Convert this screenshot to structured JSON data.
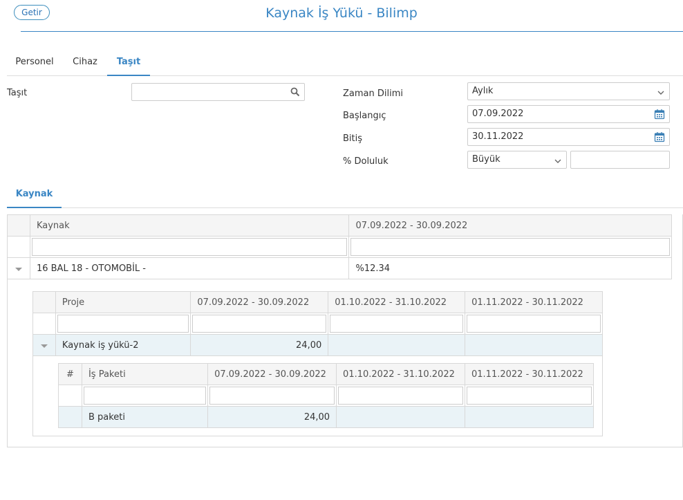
{
  "header": {
    "getir_label": "Getir",
    "title": "Kaynak İş Yükü - Bilimp"
  },
  "tabs": [
    {
      "label": "Personel"
    },
    {
      "label": "Cihaz"
    },
    {
      "label": "Taşıt"
    }
  ],
  "filters": {
    "tasit_label": "Taşıt",
    "tasit_value": "",
    "zaman_label": "Zaman Dilimi",
    "zaman_value": "Aylık",
    "baslangic_label": "Başlangıç",
    "baslangic_value": "07.09.2022",
    "bitis_label": "Bitiş",
    "bitis_value": "30.11.2022",
    "doluluk_label": "% Doluluk",
    "doluluk_op": "Büyük",
    "doluluk_value": ""
  },
  "kaynak_tab": {
    "label": "Kaynak"
  },
  "outer_grid": {
    "headers": [
      "Kaynak",
      "07.09.2022 - 30.09.2022"
    ],
    "row": {
      "name": "16 BAL 18 - OTOMOBİL -",
      "value": "%12.34"
    }
  },
  "project_grid": {
    "headers": [
      "Proje",
      "07.09.2022 - 30.09.2022",
      "01.10.2022 - 31.10.2022",
      "01.11.2022 - 30.11.2022"
    ],
    "row": {
      "name": "Kaynak iş yükü-2",
      "v1": "24,00",
      "v2": "",
      "v3": ""
    }
  },
  "package_grid": {
    "headers": [
      "#",
      "İş Paketi",
      "07.09.2022 - 30.09.2022",
      "01.10.2022 - 31.10.2022",
      "01.11.2022 - 30.11.2022"
    ],
    "row": {
      "name": "B paketi",
      "v1": "24,00",
      "v2": "",
      "v3": ""
    }
  },
  "icons": {
    "search": "search-icon",
    "calendar": "calendar-icon",
    "dropdown": "chevron-down-icon",
    "expand": "caret-down-icon"
  },
  "colors": {
    "accent": "#3a86c4",
    "highlight": "#eaf3f7"
  }
}
